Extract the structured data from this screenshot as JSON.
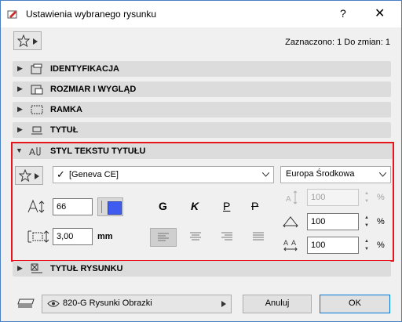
{
  "window": {
    "title": "Ustawienia wybranego rysunku",
    "help": "?",
    "close": "✕"
  },
  "status": "Zaznaczono: 1 Do zmian: 1",
  "sections": {
    "identyfikacja": "IDENTYFIKACJA",
    "rozmiar": "ROZMIAR I WYGLĄD",
    "ramka": "RAMKA",
    "tytul": "TYTUŁ",
    "styl": "STYL TEKSTU TYTUŁU",
    "tytul_rysunku": "TYTUŁ RYSUNKU"
  },
  "font": {
    "value": "[Geneva CE]",
    "check": "✓"
  },
  "encoding": {
    "value": "Europa Środkowa"
  },
  "text_size": {
    "value": "66"
  },
  "spacing": {
    "value": "3,00",
    "unit": "mm"
  },
  "styles": {
    "bold": "G",
    "italic": "K",
    "underline": "P",
    "strike": "P"
  },
  "scale": {
    "disabled_value": "100",
    "width_value": "100",
    "spacing_value": "100",
    "pct": "%"
  },
  "footer": {
    "view_name": "820-G Rysunki Obrazki",
    "cancel": "Anuluj",
    "ok": "OK"
  },
  "colors": {
    "pen": "#3f5bf0",
    "highlight": "#e8141c"
  }
}
